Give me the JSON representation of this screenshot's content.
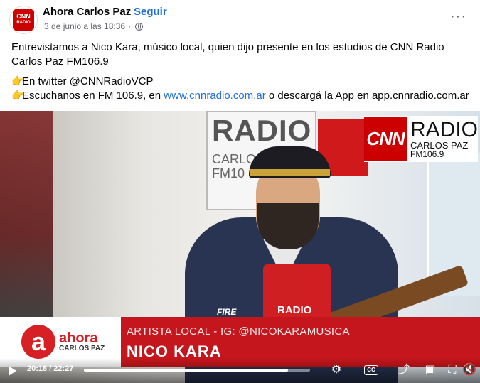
{
  "header": {
    "page_name": "Ahora Carlos Paz",
    "separator": "·",
    "follow_label": "Seguir",
    "date": "3 de junio a las 18:36",
    "meta_sep": "·",
    "more_label": "···",
    "avatar": {
      "line1": "CNN",
      "line2": "RADIO"
    }
  },
  "post": {
    "paragraph1": "Entrevistamos a Nico Kara, músico local, quien dijo presente en los estudios de CNN Radio Carlos Paz FM106.9",
    "twitter_icon": "👉",
    "twitter_text": "En twitter @CNNRadioVCP",
    "listen_icon": "👉",
    "listen_prefix": "Escuchanos en FM 106.9, en ",
    "listen_link": "www.cnnradio.com.ar",
    "listen_suffix": " o descargá la App en app.cnnradio.com.ar"
  },
  "video": {
    "studio_sign_word": "RADIO",
    "studio_sign_city": "CARLOS",
    "studio_sign_fm": "FM10",
    "jacket_text": "FIRE",
    "mic_text": "RADIO",
    "cnn_logo": {
      "brand": "CNN",
      "radio": "RADIO",
      "city": "CARLOS PAZ",
      "freq": "FM106.9"
    },
    "lower_third": {
      "logo_letter": "a",
      "logo_brand": "ahora",
      "logo_city": "CARLOS PAZ",
      "subtitle": "ARTISTA LOCAL - IG: @NICOKARAMUSICA",
      "name": "NICO KARA"
    },
    "controls": {
      "time": "20:18 / 22:27",
      "progress": 0.904,
      "cc_label": "CC"
    }
  },
  "colors": {
    "follow": "#216fdb",
    "lower_third_red": "#c4161c",
    "cnn_red": "#cc0000"
  }
}
